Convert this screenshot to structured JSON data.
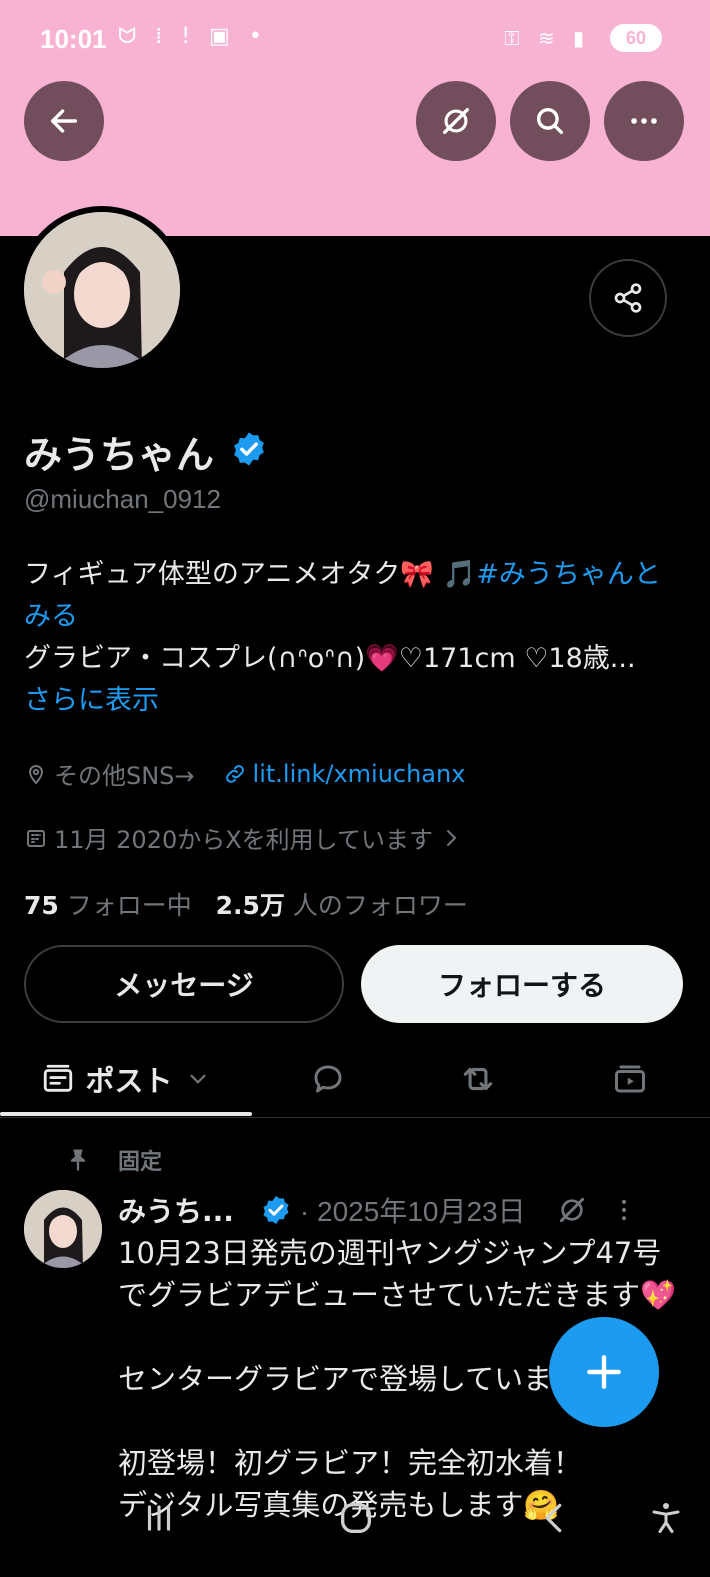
{
  "status_bar": {
    "time": "10:01",
    "left_icons": "ᗢ ⁞ ! ▣ •",
    "right_icons": "⚿ ≋ ▮",
    "battery": "60"
  },
  "profile": {
    "name": "みうちゃん",
    "handle": "@miuchan_0912",
    "bio_line1": "フィギュア体型のアニメオタク🎀 🎵",
    "bio_hashtag": "#みうちゃんとみる",
    "bio_line2": "グラビア・コスプレ(∩ᐢoᐢ∩)💗♡171cm ♡18歳...",
    "show_more": "さらに表示",
    "location": "その他SNS→",
    "website": "lit.link/xmiuchanx",
    "joined": "11月 2020からXを利用しています",
    "following_count": "75",
    "following_label": "フォロー中",
    "followers_count": "2.5万",
    "followers_label": "人のフォロワー"
  },
  "actions": {
    "message": "メッセージ",
    "follow": "フォローする"
  },
  "tabs": {
    "posts": "ポスト"
  },
  "pinned_post": {
    "pinned_label": "固定",
    "author": "みうち...",
    "date": "· 2025年10月23日",
    "body": "10月23日発売の週刊ヤングジャンプ47号でグラビアデビューさせていただきます💖\n\nセンターグラビアで登場しています🎀\n\n初登場！初グラビア！完全初水着！\nデジタル写真集の発売もします🤗"
  },
  "colors": {
    "banner": "#f8b3d2",
    "accent": "#1d9bf0",
    "background": "#000000"
  }
}
